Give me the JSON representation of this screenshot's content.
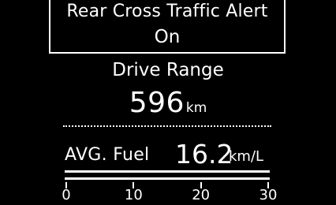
{
  "rcta": {
    "title": "Rear Cross Traffic Alert",
    "status": "On"
  },
  "range": {
    "label": "Drive Range",
    "value": "596",
    "unit": "km"
  },
  "fuel": {
    "label": "AVG. Fuel",
    "value": "16.2",
    "unit": "km/L",
    "scale": {
      "min": 0,
      "max": 30,
      "ticks": [
        "0",
        "10",
        "20",
        "30"
      ]
    }
  },
  "colors": {
    "background": "#000000",
    "foreground": "#ffffff"
  }
}
